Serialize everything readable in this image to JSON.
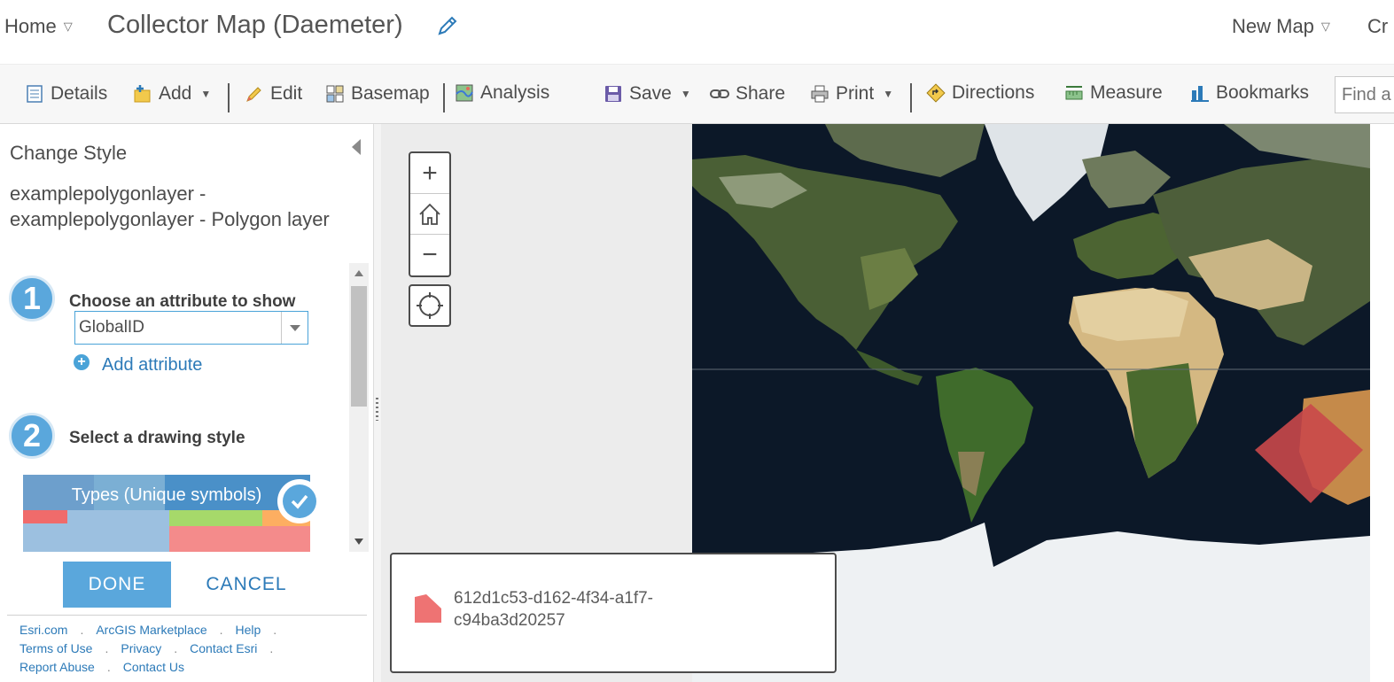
{
  "header": {
    "home_label": "Home",
    "map_title": "Collector Map (Daemeter)",
    "new_map_label": "New Map",
    "create_label_partial": "Cr"
  },
  "toolbar": {
    "details": "Details",
    "add": "Add",
    "edit": "Edit",
    "basemap": "Basemap",
    "analysis": "Analysis",
    "save": "Save",
    "share": "Share",
    "print": "Print",
    "directions": "Directions",
    "measure": "Measure",
    "bookmarks": "Bookmarks",
    "find_placeholder": "Find a"
  },
  "panel": {
    "title": "Change Style",
    "layer_name": "examplepolygonlayer - examplepolygonlayer - Polygon layer",
    "step1": {
      "number": "1",
      "label": "Choose an attribute to show"
    },
    "attribute_value": "GlobalID",
    "add_attribute": "Add attribute",
    "step2": {
      "number": "2",
      "label": "Select a drawing style"
    },
    "style_option": "Types (Unique symbols)",
    "done": "DONE",
    "cancel": "CANCEL"
  },
  "footer": {
    "links": [
      [
        "Esri.com",
        "ArcGIS Marketplace",
        "Help"
      ],
      [
        "Terms of Use",
        "Privacy",
        "Contact Esri"
      ],
      [
        "Report Abuse",
        "Contact Us"
      ]
    ]
  },
  "map": {
    "zoom_in": "+",
    "zoom_out": "−",
    "legend_value": "612d1c53-d162-4f34-a1f7-c94ba3d20257",
    "polygon_color": "#c9484a",
    "legend_swatch_color": "#ee7373"
  },
  "colors": {
    "accent": "#5aa7dc",
    "link": "#2c7ab8",
    "ocean": "#0e1a2c"
  }
}
